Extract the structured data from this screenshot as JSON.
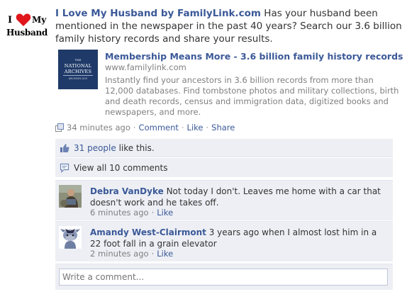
{
  "profile_pic": {
    "line1": "I",
    "line2": "My",
    "line3": "Husband",
    "heart_color": "#e0161c"
  },
  "story": {
    "actor": "I Love My Husband by FamilyLink.com",
    "message": "Has your husband been mentioned in the newspaper in the past 40 years? Search our 3.6 billion family history records and share your results."
  },
  "attachment": {
    "thumb_the": "THE",
    "thumb_name_1": "NATIONAL",
    "thumb_name_2": "ARCHIVES",
    "thumb_url": "ARCHIVES.GOV",
    "title": "Membership Means More - 3.6 billion family history records",
    "domain": "www.familylink.com",
    "description": "Instantly find your ancestors in 3.6 billion records from more than 12,000 databases. Find tombstone photos and military collections, birth and death records, census and immigration data, digitized books and newspapers, and more."
  },
  "meta": {
    "time": "34 minutes ago",
    "comment": "Comment",
    "like": "Like",
    "share": "Share",
    "separator": "·"
  },
  "likes": {
    "count_link": "31 people",
    "suffix": "like this."
  },
  "view_all": {
    "label": "View all 10 comments"
  },
  "comments": [
    {
      "name": "Debra VanDyke",
      "text": "Not today I don't. Leaves me home with a car that doesn't work and he takes off.",
      "time": "6 minutes ago",
      "like": "Like"
    },
    {
      "name": "Amandy West-Clairmont",
      "text": "3 years ago when I almost lost him in a 22 foot fall in a grain elevator",
      "time": "2 minutes ago",
      "like": "Like"
    }
  ],
  "write_comment": {
    "placeholder": "Write a comment..."
  },
  "colors": {
    "link": "#3b5998",
    "ufi_bg": "#edeff4",
    "meta_gray": "#808080",
    "thumb_bg": "#1f3a68"
  }
}
